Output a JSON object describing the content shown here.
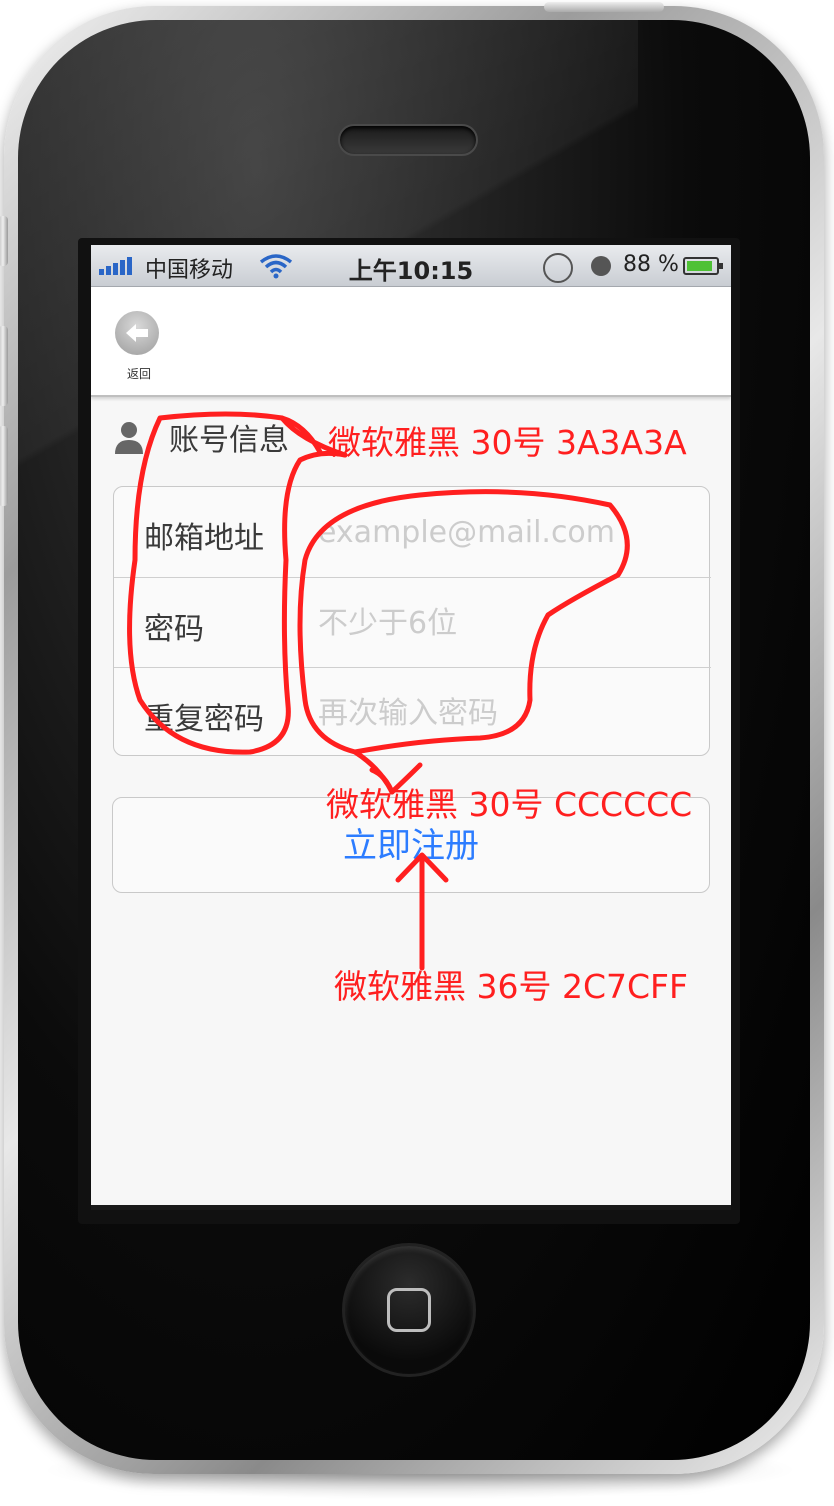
{
  "status_bar": {
    "carrier": "中国移动",
    "time": "上午10:15",
    "battery_percent": "88 %",
    "battery_level": 0.88
  },
  "navbar": {
    "back_label": "返回"
  },
  "section": {
    "title": "账号信息"
  },
  "form": {
    "email": {
      "label": "邮箱地址",
      "placeholder": "example@mail.com",
      "value": ""
    },
    "password": {
      "label": "密码",
      "placeholder": "不少于6位",
      "value": ""
    },
    "confirm_password": {
      "label": "重复密码",
      "placeholder": "再次输入密码",
      "value": ""
    }
  },
  "register_button": {
    "label": "立即注册"
  },
  "annotations": {
    "label_spec": "微软雅黑 30号  3A3A3A",
    "placeholder_spec": "微软雅黑 30号  CCCCCC",
    "button_spec": "微软雅黑 36号  2C7CFF"
  },
  "colors": {
    "label_text": "#3A3A3A",
    "placeholder_text": "#CCCCCC",
    "button_text": "#2C7CFF",
    "annotation": "#FF1F1F"
  },
  "icons": [
    "signal-icon",
    "wifi-icon",
    "rotation-lock-icon",
    "alarm-icon",
    "battery-icon",
    "back-arrow-icon",
    "user-icon",
    "home-button-icon"
  ]
}
